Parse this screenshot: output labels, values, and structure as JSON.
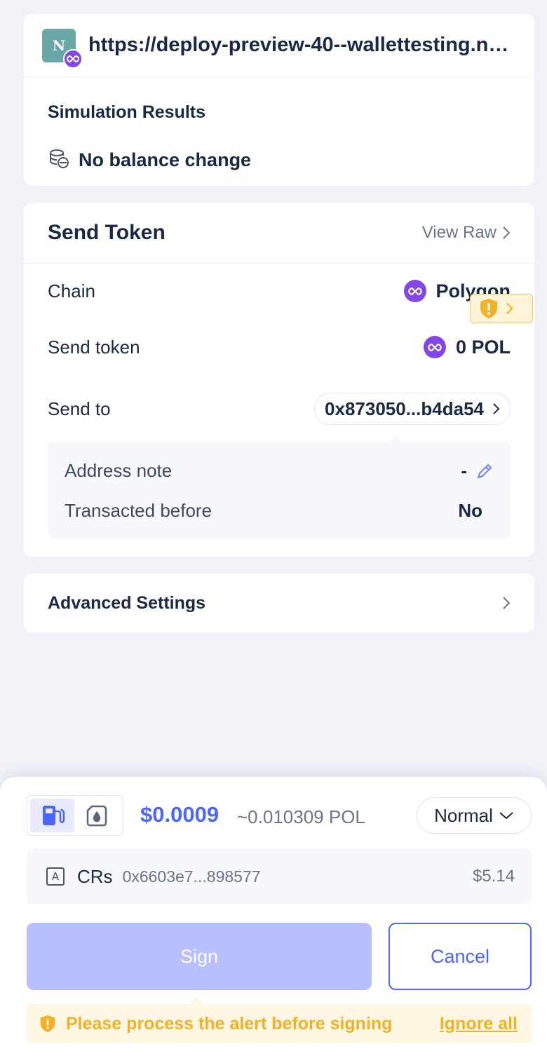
{
  "site": {
    "logo_letter": "N",
    "url": "https://deploy-preview-40--wallettesting.netlify.app"
  },
  "simulation": {
    "title": "Simulation Results",
    "balance_label": "No balance change"
  },
  "send_token": {
    "title": "Send Token",
    "view_raw": "View Raw",
    "chain_label": "Chain",
    "chain_value": "Polygon",
    "token_label": "Send token",
    "token_value": "0 POL",
    "to_label": "Send to",
    "to_value": "0x873050...b4da54",
    "address_note_label": "Address note",
    "address_note_value": "-",
    "transacted_label": "Transacted before",
    "transacted_value": "No"
  },
  "advanced": {
    "title": "Advanced Settings"
  },
  "footer": {
    "gas_usd": "$0.0009",
    "gas_native": "~0.010309 POL",
    "gas_level": "Normal",
    "account_icon_letter": "A",
    "account_name": "CRs",
    "account_address": "0x6603e7...898577",
    "account_balance": "$5.14",
    "sign_label": "Sign",
    "cancel_label": "Cancel",
    "warning": "Please process the alert before signing",
    "ignore_all": "Ignore all"
  },
  "colors": {
    "accent": "#4c65ff",
    "polygon": "#8247e5",
    "warning": "#f2b126",
    "sign_disabled": "#b8bfff"
  }
}
